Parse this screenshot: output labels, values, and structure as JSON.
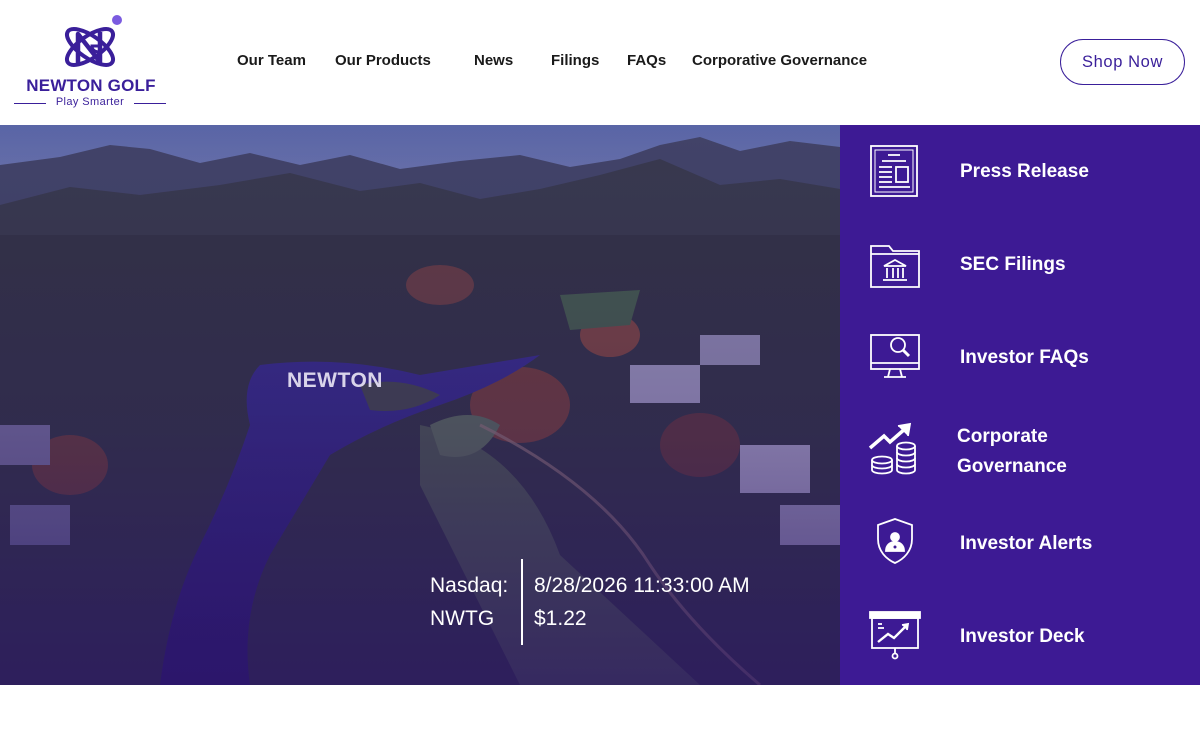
{
  "brand": {
    "name": "NEWTON GOLF",
    "tagline": "Play Smarter",
    "color": "#3a1f9a"
  },
  "nav": {
    "items": [
      "Our Team",
      "Our Products",
      "News",
      "Filings",
      "FAQs",
      "Corporative Governance"
    ]
  },
  "header": {
    "shop_label": "Shop Now"
  },
  "hero": {
    "overlay_label": "NEWTON",
    "ticker": {
      "exchange": "Nasdaq:",
      "symbol": "NWTG",
      "timestamp": "8/28/2026 11:33:00 AM",
      "price": "$1.22"
    }
  },
  "side_panel": {
    "background": "#3d1a94",
    "items": [
      {
        "label": "Press Release",
        "icon": "newspaper-icon"
      },
      {
        "label": "SEC Filings",
        "icon": "bank-folder-icon"
      },
      {
        "label": "Investor FAQs",
        "icon": "monitor-search-icon"
      },
      {
        "label": "Corporate Governance",
        "icon": "growth-coins-icon"
      },
      {
        "label": "Investor Alerts",
        "icon": "shield-user-icon"
      },
      {
        "label": "Investor Deck",
        "icon": "presentation-chart-icon"
      }
    ]
  }
}
